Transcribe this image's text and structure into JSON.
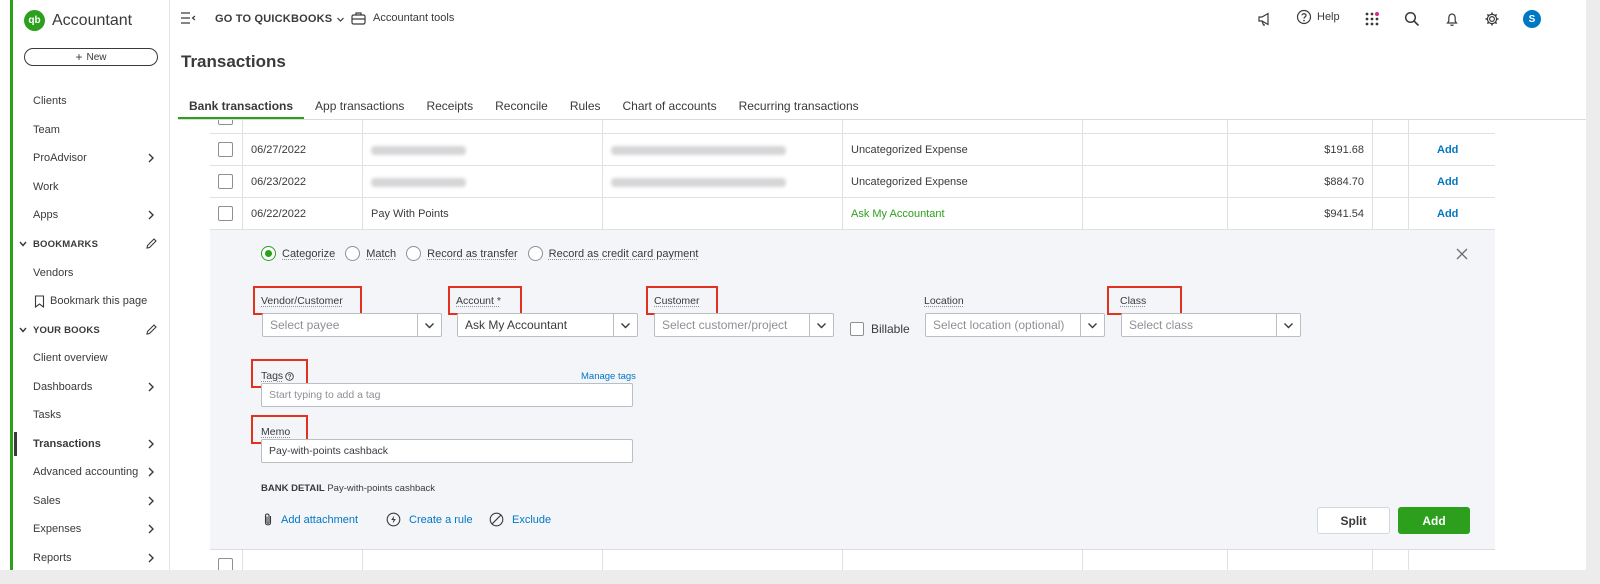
{
  "app": {
    "brand": "Accountant",
    "logo_text": "qb"
  },
  "sidebar": {
    "new_label": "New",
    "items": [
      {
        "label": "Clients",
        "chevron": false
      },
      {
        "label": "Team",
        "chevron": false
      },
      {
        "label": "ProAdvisor",
        "chevron": true
      },
      {
        "label": "Work",
        "chevron": false
      },
      {
        "label": "Apps",
        "chevron": true
      }
    ],
    "bookmarks_header": "BOOKMARKS",
    "bookmarks": [
      {
        "label": "Vendors"
      },
      {
        "label": "Bookmark this page"
      }
    ],
    "your_books_header": "YOUR BOOKS",
    "books": [
      {
        "label": "Client overview",
        "chevron": false
      },
      {
        "label": "Dashboards",
        "chevron": true
      },
      {
        "label": "Tasks",
        "chevron": false
      },
      {
        "label": "Transactions",
        "chevron": true,
        "active": true
      },
      {
        "label": "Advanced accounting",
        "chevron": true
      },
      {
        "label": "Sales",
        "chevron": true
      },
      {
        "label": "Expenses",
        "chevron": true
      },
      {
        "label": "Reports",
        "chevron": true
      }
    ]
  },
  "topbar": {
    "goto_quickbooks": "GO TO QUICKBOOKS",
    "accountant_tools": "Accountant tools",
    "help": "Help",
    "avatar_letter": "S"
  },
  "page": {
    "title": "Transactions"
  },
  "tabs": [
    {
      "label": "Bank transactions",
      "active": true
    },
    {
      "label": "App transactions"
    },
    {
      "label": "Receipts"
    },
    {
      "label": "Reconcile"
    },
    {
      "label": "Rules"
    },
    {
      "label": "Chart of accounts"
    },
    {
      "label": "Recurring transactions"
    }
  ],
  "rows": [
    {
      "date": "06/27/2022",
      "category": "Uncategorized Expense",
      "amount": "$191.68",
      "action": "Add"
    },
    {
      "date": "06/23/2022",
      "category": "Uncategorized Expense",
      "amount": "$884.70",
      "action": "Add"
    },
    {
      "date": "06/22/2022",
      "description": "Pay With Points",
      "category": "Ask My Accountant",
      "amount": "$941.54",
      "action": "Add"
    }
  ],
  "panel": {
    "radios": [
      {
        "label": "Categorize",
        "selected": true
      },
      {
        "label": "Match",
        "selected": false
      },
      {
        "label": "Record as transfer",
        "selected": false
      },
      {
        "label": "Record as credit card payment",
        "selected": false
      }
    ],
    "fields": {
      "vendor_label": "Vendor/Customer",
      "vendor_placeholder": "Select payee",
      "account_label": "Account *",
      "account_value": "Ask My Accountant",
      "customer_label": "Customer",
      "customer_placeholder": "Select customer/project",
      "billable_label": "Billable",
      "location_label": "Location",
      "location_placeholder": "Select location (optional)",
      "class_label": "Class",
      "class_placeholder": "Select class",
      "tags_label": "Tags",
      "manage_tags": "Manage tags",
      "tags_placeholder": "Start typing to add a tag",
      "memo_label": "Memo",
      "memo_value": "Pay-with-points cashback"
    },
    "bank_detail_label": "BANK DETAIL",
    "bank_detail_value": "Pay-with-points cashback",
    "actions": {
      "add_attachment": "Add attachment",
      "create_rule": "Create a rule",
      "exclude": "Exclude"
    },
    "split_label": "Split",
    "add_label": "Add"
  },
  "colors": {
    "brand_green": "#2ca01c",
    "link_blue": "#0077c5",
    "highlight_red": "#e0321e"
  }
}
